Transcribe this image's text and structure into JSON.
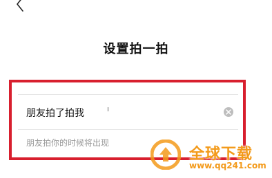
{
  "header": {
    "back_icon": "chevron-left-icon",
    "title": "设置拍一拍"
  },
  "form": {
    "input_value": "朋友拍了拍我",
    "clear_icon": "clear-circle-icon",
    "hint": "朋友拍你的时候将出现"
  },
  "annotation": {
    "frame_color": "#d81f2e"
  },
  "watermark": {
    "name": "全球下载",
    "url": "www.qq241.com",
    "color": "#f39a1a"
  }
}
